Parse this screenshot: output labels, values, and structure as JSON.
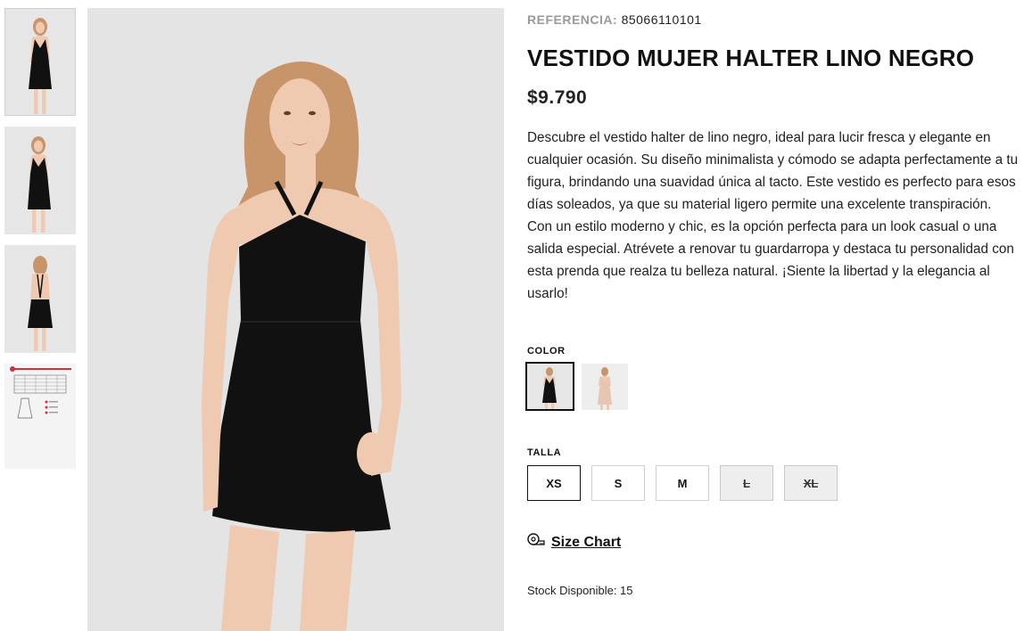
{
  "product": {
    "reference_label": "REFERENCIA:",
    "reference_value": "85066110101",
    "title": "VESTIDO MUJER HALTER LINO NEGRO",
    "price": "$9.790",
    "description": "Descubre el vestido halter de lino negro, ideal para lucir fresca y elegante en cualquier ocasión. Su diseño minimalista y cómodo se adapta perfectamente a tu figura, brindando una suavidad única al tacto. Este vestido es perfecto para esos días soleados, ya que su material ligero permite una excelente transpiración. Con un estilo moderno y chic, es la opción perfecta para un look casual o una salida especial. Atrévete a renovar tu guardarropa y destaca tu personalidad con esta prenda que realza tu belleza natural. ¡Siente la libertad y la elegancia al usarlo!"
  },
  "color": {
    "label": "COLOR",
    "options": [
      {
        "name": "negro",
        "selected": true,
        "swatch": "#111111"
      },
      {
        "name": "nude",
        "selected": false,
        "swatch": "#e8c4b3"
      }
    ]
  },
  "size": {
    "label": "TALLA",
    "options": [
      {
        "label": "XS",
        "state": "selected"
      },
      {
        "label": "S",
        "state": "available"
      },
      {
        "label": "M",
        "state": "available"
      },
      {
        "label": "L",
        "state": "unavailable"
      },
      {
        "label": "XL",
        "state": "unavailable"
      }
    ]
  },
  "size_chart": {
    "label": "Size Chart",
    "icon": "measuring-tape-icon"
  },
  "stock": {
    "text": "Stock Disponible: 15"
  },
  "gallery": {
    "thumbnails": [
      "front-view",
      "front-view-2",
      "back-view",
      "size-chart"
    ],
    "active_index": 0
  },
  "colors": {
    "dress": "#111111",
    "background": "#e4e4e4",
    "hair": "#c8956b",
    "skin": "#efc9b0",
    "accent_red": "#d0323a"
  }
}
